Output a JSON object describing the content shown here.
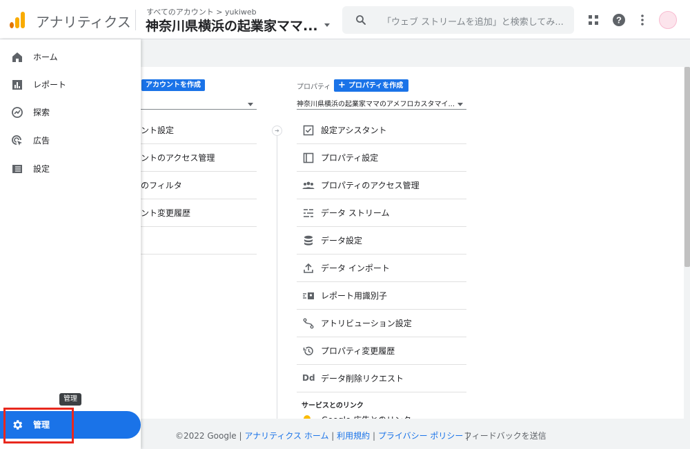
{
  "header": {
    "app_name": "アナリティクス",
    "breadcrumb": "すべてのアカウント > yukiweb",
    "property_title": "神奈川県横浜の起業家ママ...",
    "search_placeholder": "「ウェブ ストリームを追加」と検索してみ...",
    "brand_colors": [
      "#f9ab00",
      "#e37400"
    ]
  },
  "nav": {
    "items": [
      {
        "label": "ホーム",
        "icon": "home-icon"
      },
      {
        "label": "レポート",
        "icon": "bar-chart-icon"
      },
      {
        "label": "探索",
        "icon": "explore-icon"
      },
      {
        "label": "広告",
        "icon": "ads-target-icon"
      },
      {
        "label": "設定",
        "icon": "list-settings-icon"
      }
    ],
    "active": {
      "label": "管理",
      "icon": "gear-icon"
    },
    "tooltip": "管理",
    "accent": "#1a73e8",
    "highlight_color": "#e8281d"
  },
  "account": {
    "create_button": "アカウントを作成",
    "items": [
      "ント設定",
      "ントのアクセス管理",
      "のフィルタ",
      "ント変更履歴"
    ]
  },
  "property": {
    "label": "プロパティ",
    "create_button": "プロパティを作成",
    "selected": "神奈川県横浜の起業家ママのアメフロカスタマイ...",
    "items": [
      {
        "label": "設定アシスタント",
        "icon": "checklist-icon"
      },
      {
        "label": "プロパティ設定",
        "icon": "property-settings-icon"
      },
      {
        "label": "プロパティのアクセス管理",
        "icon": "people-icon"
      },
      {
        "label": "データ ストリーム",
        "icon": "data-stream-icon"
      },
      {
        "label": "データ設定",
        "icon": "database-icon"
      },
      {
        "label": "データ インポート",
        "icon": "upload-icon"
      },
      {
        "label": "レポート用識別子",
        "icon": "identifier-icon"
      },
      {
        "label": "アトリビューション設定",
        "icon": "attribution-icon"
      },
      {
        "label": "プロパティ変更履歴",
        "icon": "history-icon"
      },
      {
        "label": "データ削除リクエスト",
        "icon": "dd-icon"
      }
    ],
    "links_heading": "サービスとのリンク",
    "links_first": "Google 広告とのリンク"
  },
  "footer": {
    "copyright": "©2022 Google",
    "links": [
      "アナリティクス ホーム",
      "利用規約",
      "プライバシー ポリシー"
    ],
    "feedback": "フィードバックを送信"
  }
}
